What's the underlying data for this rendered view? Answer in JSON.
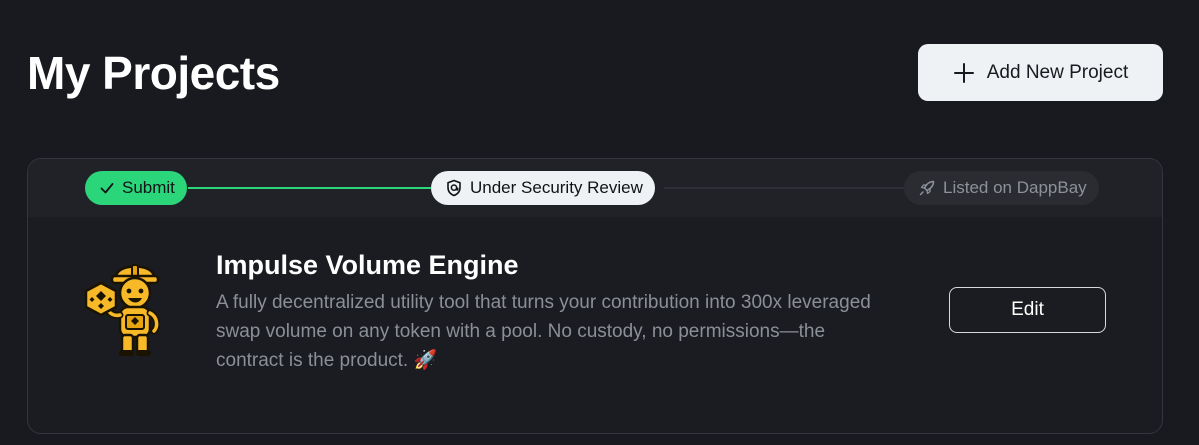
{
  "header": {
    "title": "My Projects",
    "add_button_label": "Add New Project"
  },
  "project": {
    "steps": [
      {
        "label": "Submit",
        "status": "complete",
        "icon": "check-icon"
      },
      {
        "label": "Under Security Review",
        "status": "current",
        "icon": "shield-icon"
      },
      {
        "label": "Listed on DappBay",
        "status": "pending",
        "icon": "rocket-icon"
      }
    ],
    "name": "Impulse Volume Engine",
    "description": "A fully decentralized utility tool that turns your contribution into 300x leveraged swap volume on any token with a pool. No custody, no permissions—the contract is the product. 🚀",
    "logo_icon": "builder-mascot-icon",
    "edit_label": "Edit"
  },
  "colors": {
    "background": "#181a1f",
    "accent_green": "#2bd67b",
    "button_light": "#eef2f4",
    "mascot_yellow": "#f7b928"
  }
}
